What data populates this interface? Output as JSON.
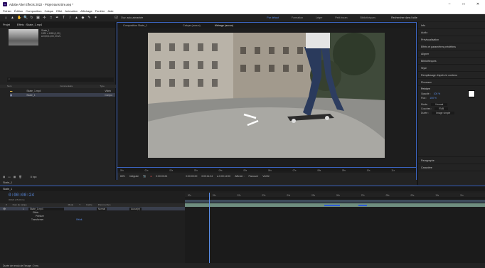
{
  "window": {
    "title": "Adobe After Effects 2022 - Projet sans titre.aep *",
    "app_badge": "Ae",
    "min": "–",
    "max": "□",
    "close": "✕"
  },
  "menu": [
    "Fichier",
    "Édition",
    "Composition",
    "Calque",
    "Effet",
    "Animation",
    "Affichage",
    "Fenêtre",
    "Aide"
  ],
  "toolbar": {
    "snap_label": "Ouv. auto-aimantée",
    "workspaces": [
      "Par défaut",
      "Formation",
      "Léger",
      "Petit écran",
      "Bibliothèques"
    ],
    "active_workspace": "Par défaut",
    "search_placeholder": "Rechercher dans l'aide"
  },
  "project": {
    "tab": "Projet",
    "tab2": "Effets : Skate_1.mp4",
    "item_name": "Skate_1",
    "item_info": [
      "1920 x 1080 (1,00)",
      "Δ 0;00;11;00, 25 i/s"
    ],
    "columns": [
      "Nom",
      "Commentaire",
      "Type"
    ],
    "rows": [
      {
        "name": "Skate_1.mp4",
        "type": "Vidéo"
      },
      {
        "name": "Skate_1",
        "type": "Compo"
      }
    ],
    "bpc": "8 bpc"
  },
  "viewer": {
    "tabs": [
      "Composition Skate_1",
      "Calque (aucun)",
      "Métrage (aucun)"
    ],
    "zoom": "65%",
    "quality": "Intégrale",
    "timecode": "0:00:00:24",
    "ruler_ticks": [
      "00s",
      "01s",
      "02s",
      "03s",
      "04s",
      "05s",
      "06s",
      "07s",
      "08s",
      "09s",
      "10s",
      "11s"
    ],
    "controls": [
      "0:00:00:00",
      "0:00:11:24",
      "Δ 0:00:12:00",
      "Afficher :",
      "Parcourir",
      "Vérifié"
    ]
  },
  "right_panel": {
    "items": [
      "Info",
      "Audio",
      "Prévisualisation",
      "Effets et paramètres prédéfinis",
      "Aligner",
      "Bibliothèques",
      "Style",
      "Remplissage d'après le contenu",
      "Pinceaux",
      "Peinture",
      "Paragraphe",
      "Caractère"
    ],
    "paint": {
      "title": "Peinture",
      "opacity_label": "Opacité :",
      "opacity": "100 %",
      "flux_label": "Flux :",
      "flux": "100 %",
      "mode_label": "Mode :",
      "mode": "Normal",
      "channels_label": "Couches :",
      "channels": "RVB",
      "duration_label": "Durée :",
      "duration": "Image simple"
    }
  },
  "timeline": {
    "tab": "Skate_1",
    "timecode": "0:00:00:24",
    "fps": "00024 (25,00 i/s)",
    "columns": [
      "#",
      "Nom du calque",
      "Mode",
      "T",
      "Cache",
      "Parent et lien"
    ],
    "layer": {
      "index": "1",
      "name": "Skate_1.mp4",
      "mode": "Normal",
      "parent": "Aucun(e)"
    },
    "sub": [
      "Effets",
      "Peinture",
      "Transformer"
    ],
    "reset": "Réinit.",
    "ruler_ticks": [
      "00s",
      "01s",
      "02s",
      "03s",
      "04s",
      "05s",
      "06s",
      "07s",
      "08s",
      "09s",
      "10s",
      "11s"
    ],
    "bottom": "Durée de rendu de l'image : 0 ms"
  }
}
